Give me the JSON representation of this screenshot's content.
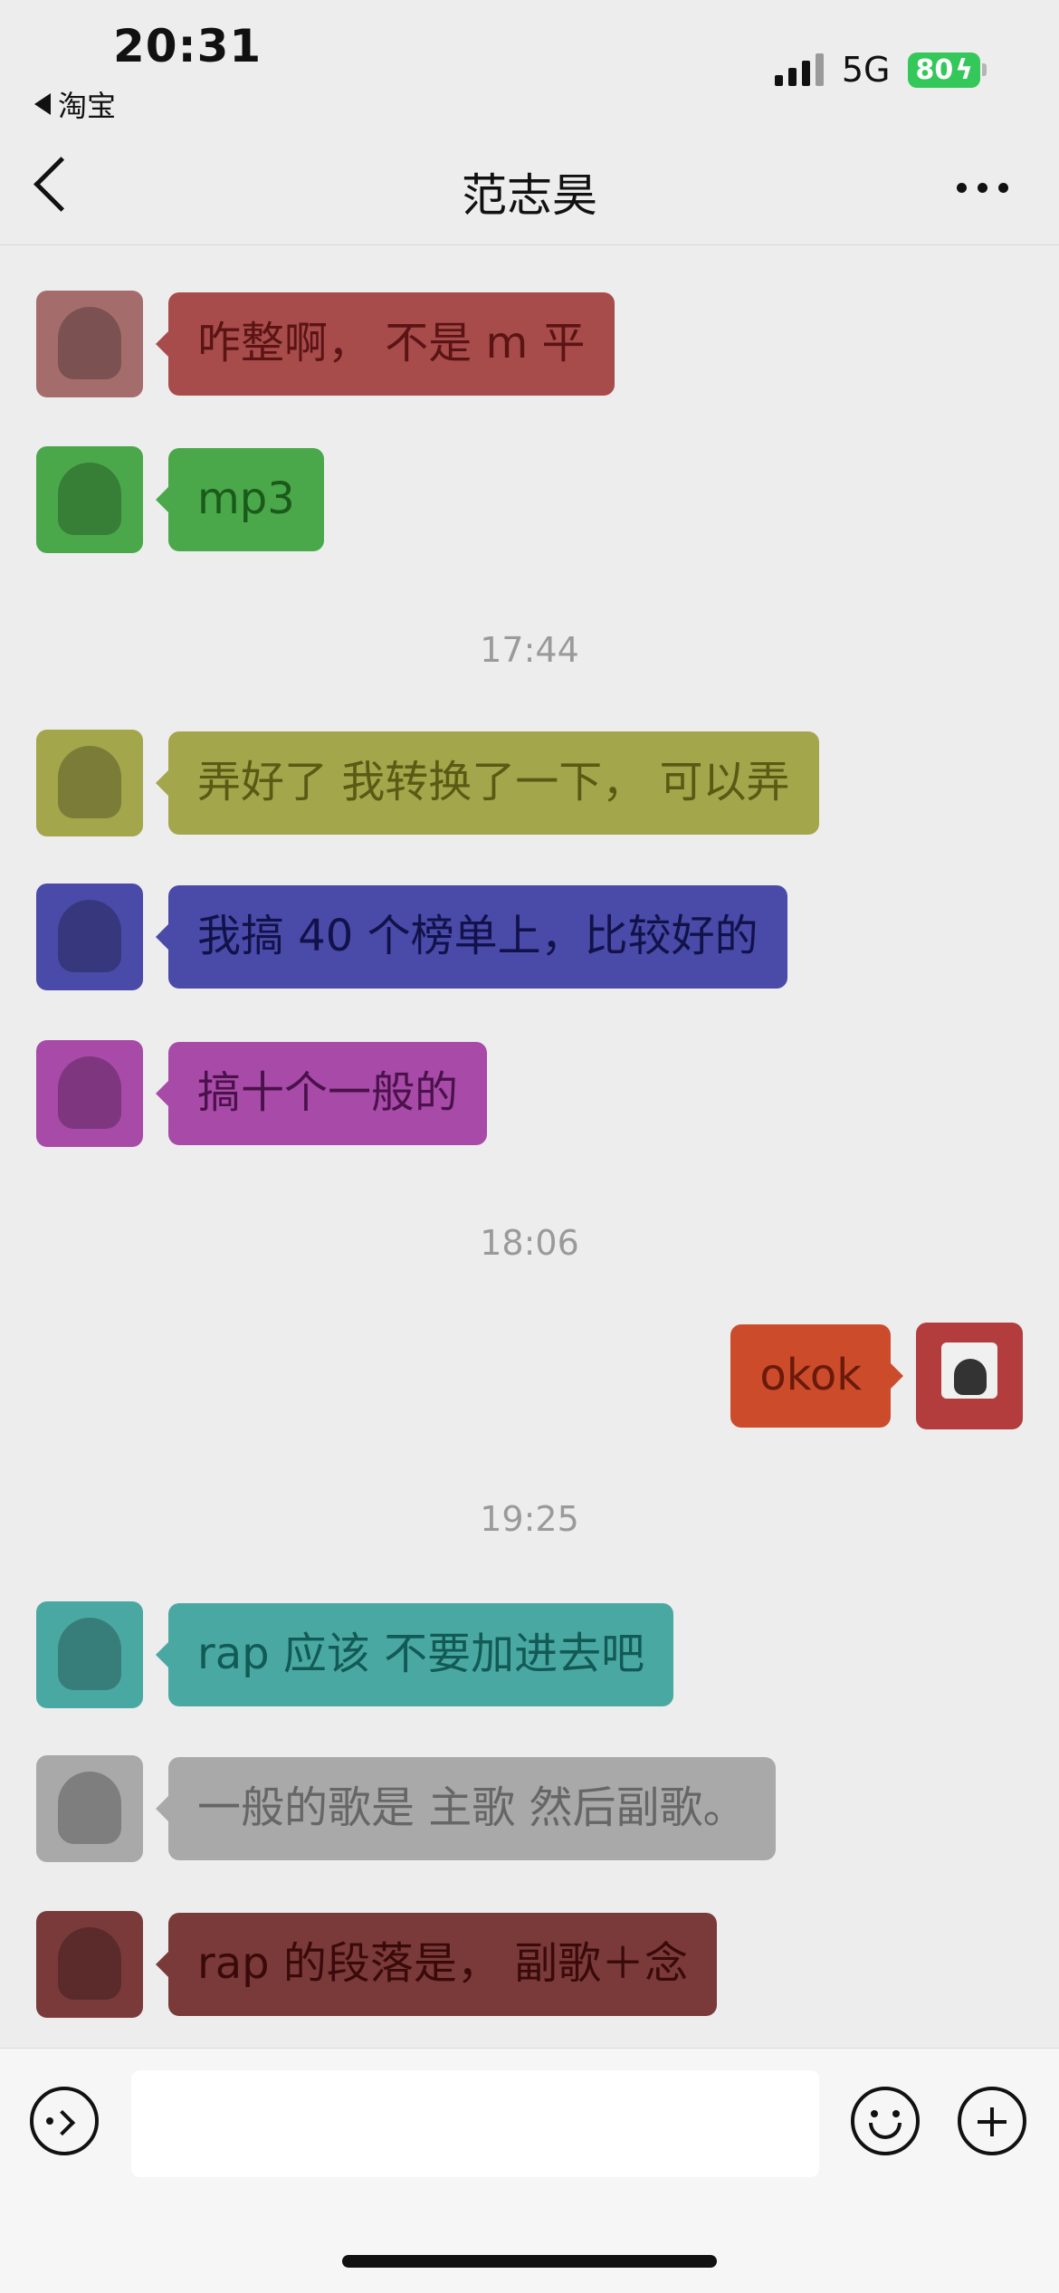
{
  "status_bar": {
    "time": "20:31",
    "back_app": "淘宝",
    "network": "5G",
    "battery": "80"
  },
  "nav": {
    "title": "范志昊"
  },
  "messages": [
    {
      "side": "left",
      "text": "咋整啊， 不是 m 平",
      "bubble_color": "#a84b4b",
      "text_color": "#5a1414"
    },
    {
      "side": "left",
      "text": "mp3",
      "bubble_color": "#4aa84a",
      "text_color": "#1a5a1a"
    },
    {
      "side": "left",
      "text": "弄好了 我转换了一下， 可以弄",
      "bubble_color": "#a3a64a",
      "text_color": "#5a5a14"
    },
    {
      "side": "left",
      "text": "我搞 40 个榜单上，比较好的",
      "bubble_color": "#4a4aa8",
      "text_color": "#12124a"
    },
    {
      "side": "left",
      "text": "搞十个一般的",
      "bubble_color": "#a84aa8",
      "text_color": "#4a124a"
    },
    {
      "side": "right",
      "text": "okok",
      "bubble_color": "#cc4b2a",
      "text_color": "#6a1a0a"
    },
    {
      "side": "left",
      "text": "rap 应该 不要加进去吧",
      "bubble_color": "#4aa8a3",
      "text_color": "#125a55"
    },
    {
      "side": "left",
      "text": "一般的歌是 主歌 然后副歌。",
      "bubble_color": "#a9a9a9",
      "text_color": "#666666"
    },
    {
      "side": "left",
      "text": "rap 的段落是， 副歌＋念",
      "bubble_color": "#7a3a3a",
      "text_color": "#3a0a0a"
    }
  ],
  "timestamps": [
    "17:44",
    "18:06",
    "19:25"
  ],
  "input": {
    "placeholder": ""
  },
  "icons": {
    "voice": "voice-icon",
    "emoji": "emoji-icon",
    "plus": "plus-icon",
    "back": "chevron-left-icon",
    "more": "more-icon"
  }
}
